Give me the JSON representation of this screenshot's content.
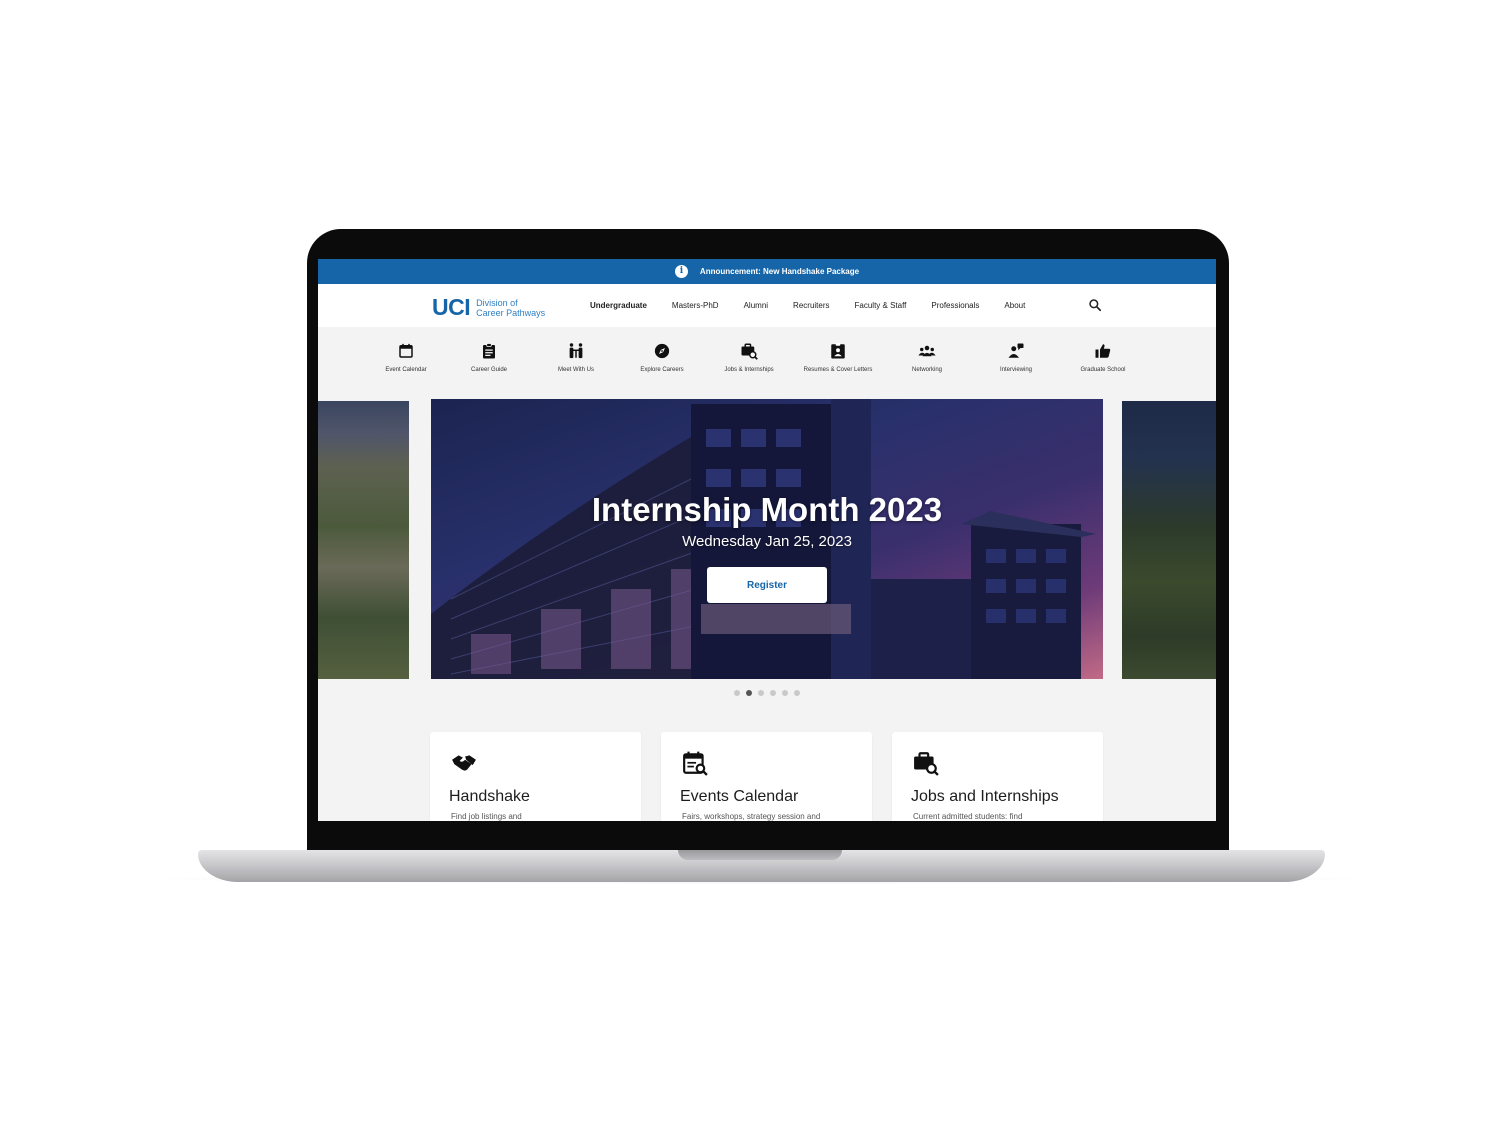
{
  "announcement": {
    "text": "Announcement: New Handshake Package"
  },
  "brand": {
    "mark": "UCI",
    "line1": "Division of",
    "line2": "Career Pathways"
  },
  "nav": {
    "items": [
      {
        "label": "Undergraduate",
        "active": true
      },
      {
        "label": "Masters-PhD"
      },
      {
        "label": "Alumni"
      },
      {
        "label": "Recruiters"
      },
      {
        "label": "Faculty & Staff"
      },
      {
        "label": "Professionals"
      },
      {
        "label": "About"
      }
    ],
    "search_icon": "search-icon"
  },
  "quick_links": [
    {
      "label": "Event Calendar",
      "icon": "calendar-icon"
    },
    {
      "label": "Career Guide",
      "icon": "clipboard-icon"
    },
    {
      "label": "Meet With Us",
      "icon": "people-icon"
    },
    {
      "label": "Explore Careers",
      "icon": "compass-icon"
    },
    {
      "label": "Jobs & Internships",
      "icon": "briefcase-search-icon"
    },
    {
      "label": "Resumes & Cover Letters",
      "icon": "id-badge-icon"
    },
    {
      "label": "Networking",
      "icon": "group-icon"
    },
    {
      "label": "Interviewing",
      "icon": "interview-icon"
    },
    {
      "label": "Graduate School",
      "icon": "thumbs-up-icon"
    }
  ],
  "hero": {
    "title": "Internship Month 2023",
    "subtitle": "Wednesday Jan 25, 2023",
    "button": "Register",
    "slide_count": 6,
    "active_slide": 2
  },
  "cards": [
    {
      "title": "Handshake",
      "desc": "Find job listings and",
      "icon": "handshake-icon"
    },
    {
      "title": "Events Calendar",
      "desc": "Fairs, workshops, strategy session and",
      "icon": "calendar-search-icon"
    },
    {
      "title": "Jobs and Internships",
      "desc": "Current admitted students: find",
      "icon": "briefcase-search-icon"
    }
  ],
  "colors": {
    "brand_blue": "#1565a8",
    "text_dark": "#222222",
    "background": "#f3f3f3"
  }
}
